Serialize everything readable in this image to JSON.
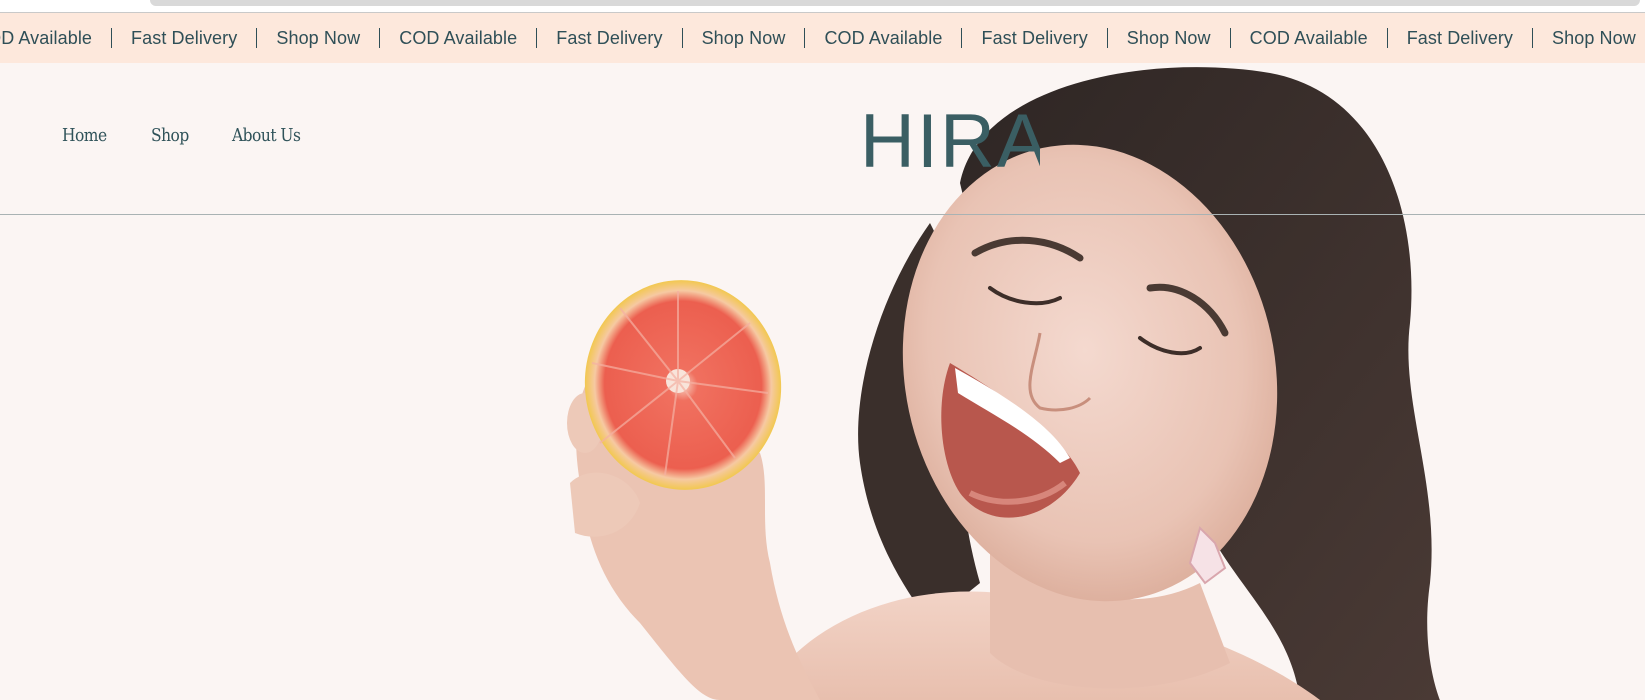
{
  "marquee": {
    "items": [
      "COD Available",
      "Fast Delivery",
      "Shop Now",
      "COD Available",
      "Fast Delivery",
      "Shop Now",
      "COD Available",
      "Fast Delivery",
      "Shop Now",
      "COD Available",
      "Fast Delivery",
      "Shop Now"
    ]
  },
  "header": {
    "nav": [
      {
        "label": "Home"
      },
      {
        "label": "Shop"
      },
      {
        "label": "About Us"
      }
    ],
    "logo_text": "HIRA"
  },
  "colors": {
    "marquee_bg": "#fde8dc",
    "brand_teal": "#2f5259",
    "page_bg": "#fbf5f3"
  }
}
